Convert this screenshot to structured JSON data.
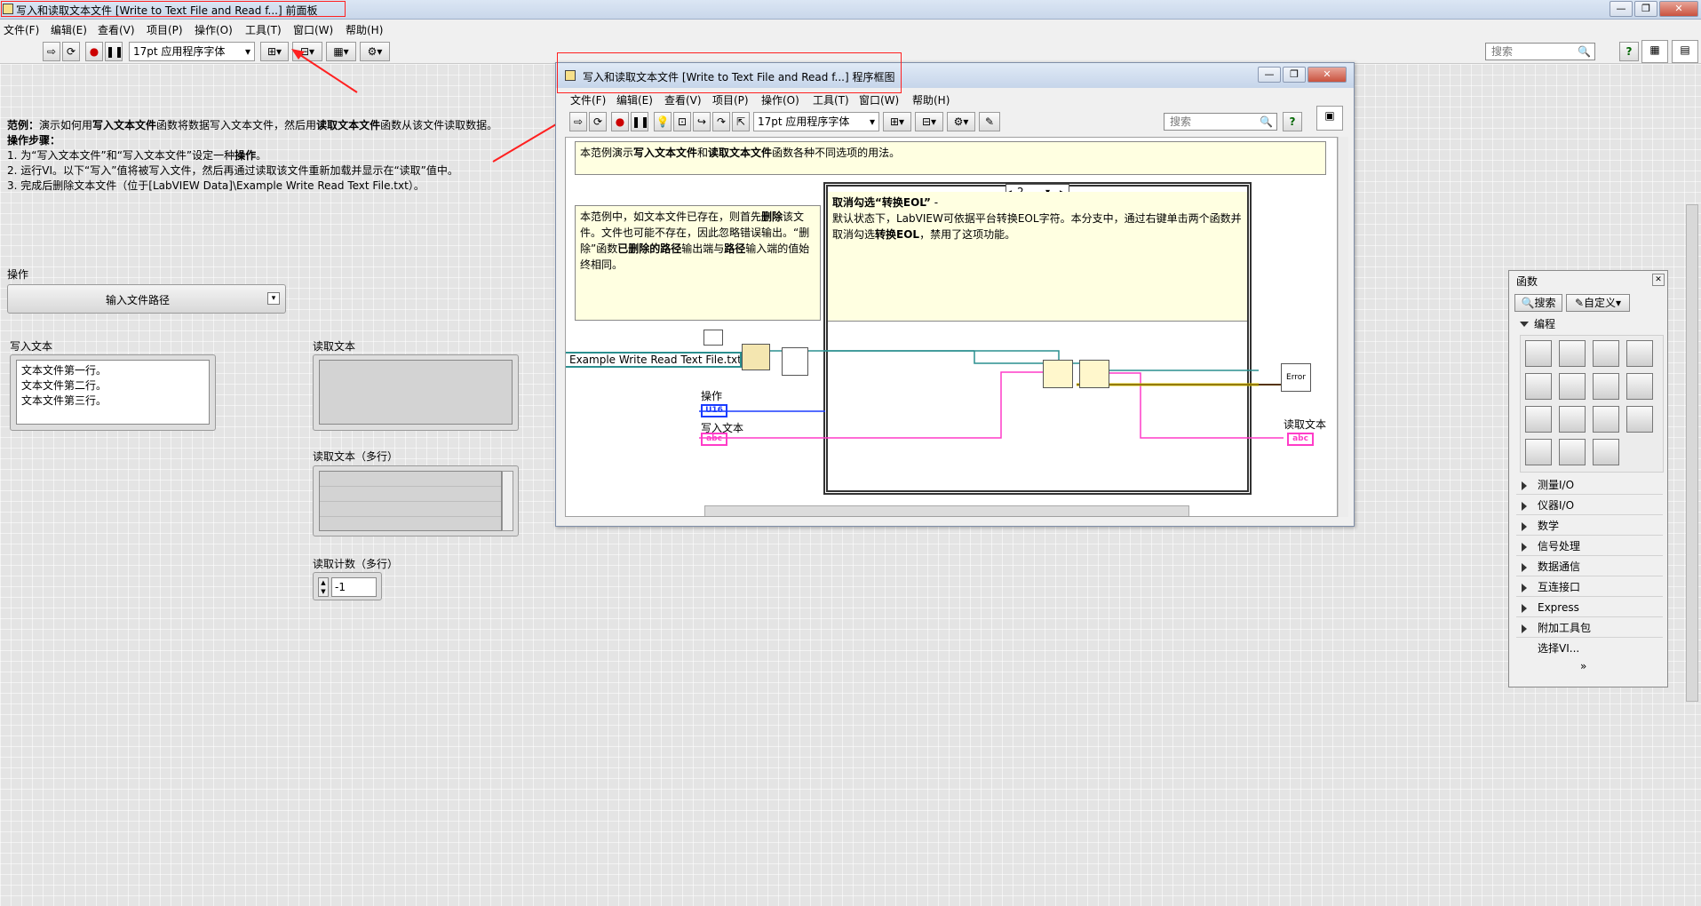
{
  "front_panel": {
    "title": "写入和读取文本文件 [Write to Text File and Read f...] 前面板",
    "menu": [
      "文件(F)",
      "编辑(E)",
      "查看(V)",
      "项目(P)",
      "操作(O)",
      "工具(T)",
      "窗口(W)",
      "帮助(H)"
    ],
    "font_select": "17pt 应用程序字体",
    "search_placeholder": "搜索",
    "window_buttons": [
      "—",
      "❐",
      "✕"
    ],
    "description": {
      "example_prefix": "范例：",
      "example_text": "演示如何用",
      "example_bold1": "写入文本文件",
      "example_mid": "函数将数据写入文本文件，然后用",
      "example_bold2": "读取文本文件",
      "example_end": "函数从该文件读取数据。",
      "steps_title": "操作步骤：",
      "step1_a": "1. 为“写入文本文件”和“写入文本文件”设定一种",
      "step1_bold": "操作",
      "step1_b": "。",
      "step2": "2. 运行VI。以下“写入”值将被写入文件，然后再通过读取该文件重新加载并显示在“读取”值中。",
      "step3": "3. 完成后删除文本文件（位于[LabVIEW Data]\\Example Write Read Text File.txt）。"
    },
    "operation_label": "操作",
    "operation_value": "输入文件路径",
    "write_text_label": "写入文本",
    "write_text_lines": [
      "文本文件第一行。",
      "文本文件第二行。",
      "文本文件第三行。"
    ],
    "read_text_label": "读取文本",
    "read_text_multi_label": "读取文本（多行）",
    "read_count_label": "读取计数（多行）",
    "read_count_value": "-1"
  },
  "block_diagram": {
    "title": "写入和读取文本文件 [Write to Text File and Read f...] 程序框图",
    "menu": [
      "文件(F)",
      "编辑(E)",
      "查看(V)",
      "项目(P)",
      "操作(O)",
      "工具(T)",
      "窗口(W)",
      "帮助(H)"
    ],
    "font_select": "17pt 应用程序字体",
    "search_placeholder": "搜索",
    "top_comment_a": "本范例演示",
    "top_comment_b1": "写入文本文件",
    "top_comment_and": "和",
    "top_comment_b2": "读取文本文件",
    "top_comment_c": "函数各种不同选项的用法。",
    "left_comment_a": "本范例中，如文本文件已存在，则首先",
    "left_comment_bold1": "删除",
    "left_comment_b": "该文件。文件也可能不存在，因此忽略错误输出。“删除”函数",
    "left_comment_bold2": "已删除的路径",
    "left_comment_c": "输出端与",
    "left_comment_bold3": "路径",
    "left_comment_d": "输入端的值始终相同。",
    "case_selector": "2",
    "case_comment_title": "取消勾选“转换EOL”",
    "case_comment_dash": " -",
    "case_comment_a": "默认状态下，LabVIEW可依据平台转换EOL字符。本分支中，通过右键单击两个函数并取消勾选",
    "case_comment_bold": "转换EOL",
    "case_comment_b": "，禁用了这项功能。",
    "path_constant": "Example Write Read Text File.txt",
    "op_label": "操作",
    "op_terminal": "U16",
    "write_label": "写入文本",
    "write_terminal": "abc",
    "read_label": "读取文本",
    "read_terminal": "abc",
    "error_node": "Error"
  },
  "functions_palette": {
    "title": "函数",
    "search_btn": "搜索",
    "custom_btn": "自定义▾",
    "category": "编程",
    "rows": [
      "测量I/O",
      "仪器I/O",
      "数学",
      "信号处理",
      "数据通信",
      "互连接口",
      "Express",
      "附加工具包",
      "选择VI..."
    ],
    "expand": "»"
  },
  "colors": {
    "annotation_red": "#ff2020",
    "wire_pink": "#ff3cc8",
    "wire_teal": "#2a8f8f",
    "wire_blue": "#1a3cff",
    "comment_bg": "#ffffe1"
  }
}
